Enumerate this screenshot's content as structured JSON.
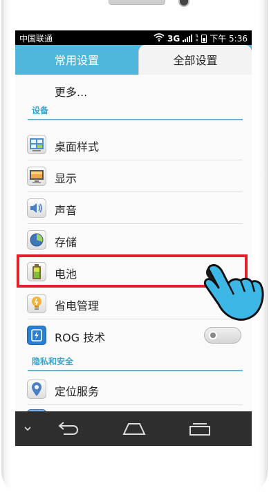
{
  "statusbar": {
    "carrier": "中国联通",
    "network": "3G",
    "time": "下午 5:36"
  },
  "tabs": [
    {
      "label": "常用设置",
      "selected": false
    },
    {
      "label": "全部设置",
      "selected": true
    }
  ],
  "more_label": "更多...",
  "sections": {
    "device": "设备",
    "privacy": "隐私和安全"
  },
  "items": [
    {
      "label": "桌面样式",
      "icon": "desktop-style-icon"
    },
    {
      "label": "显示",
      "icon": "display-icon"
    },
    {
      "label": "声音",
      "icon": "sound-icon"
    },
    {
      "label": "存储",
      "icon": "storage-icon"
    },
    {
      "label": "电池",
      "icon": "battery-icon",
      "highlighted": true
    },
    {
      "label": "省电管理",
      "icon": "power-saving-icon"
    },
    {
      "label": "ROG 技术",
      "icon": "rog-icon",
      "toggle": "off"
    },
    {
      "label": "定位服务",
      "icon": "location-icon"
    }
  ],
  "navbar": [
    "menu-collapse-icon",
    "back-icon",
    "home-icon",
    "recent-apps-icon"
  ],
  "colors": {
    "tab_bar": "#4fb7dc",
    "section_text": "#3aa5cf",
    "highlight_border": "#e0212b",
    "hand_fill": "#3db8e6"
  }
}
